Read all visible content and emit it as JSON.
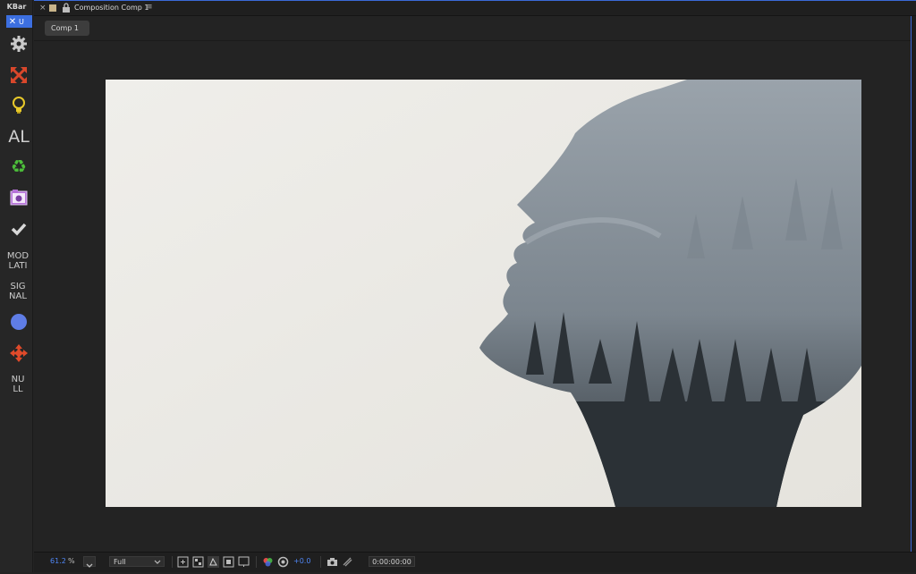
{
  "kbar": {
    "title": "KBar",
    "tab_close": "✕",
    "tab_label": "U",
    "buttons": [
      {
        "name": "settings-icon",
        "text": ""
      },
      {
        "name": "expand-arrows-icon",
        "text": ""
      },
      {
        "name": "lightbulb-icon",
        "text": ""
      },
      {
        "name": "al-text",
        "text": "AL"
      },
      {
        "name": "recycle-icon",
        "text": ""
      },
      {
        "name": "camera-icon",
        "text": ""
      },
      {
        "name": "checkmark-icon",
        "text": ""
      },
      {
        "name": "modulate-text",
        "text": "MOD\nLATI"
      },
      {
        "name": "signal-text",
        "text": "SIG\nNAL"
      },
      {
        "name": "blue-circle-icon",
        "text": ""
      },
      {
        "name": "move-anchor-icon",
        "text": ""
      },
      {
        "name": "null-text",
        "text": "NU\nLL"
      }
    ]
  },
  "header": {
    "close": "×",
    "title": "Composition Comp 1",
    "menu": "≡"
  },
  "tabs": {
    "active": "Comp 1"
  },
  "toolbar": {
    "zoom_value": "61.2",
    "zoom_unit": "%",
    "resolution": "Full",
    "exposure": "+0.0",
    "timecode": "0:00:00:00"
  },
  "colors": {
    "accent": "#3c6fe0",
    "panel": "#232323",
    "header": "#1f1f1f"
  }
}
